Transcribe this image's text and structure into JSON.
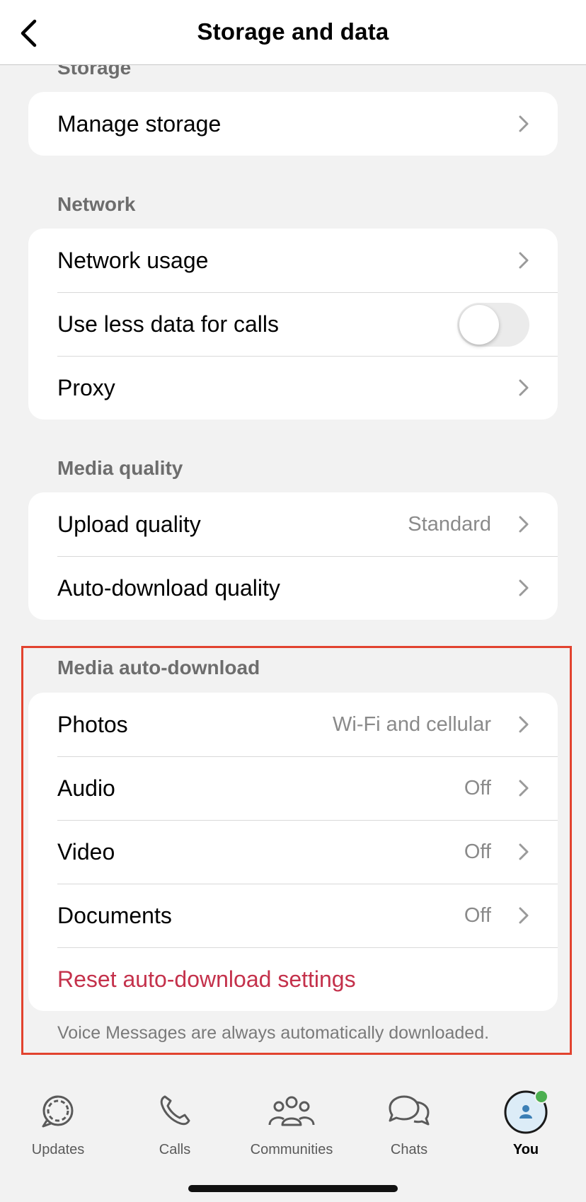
{
  "header": {
    "title": "Storage and data",
    "back_icon": "chevron-left-icon"
  },
  "sections": {
    "storage": {
      "title": "Storage",
      "rows": [
        {
          "label": "Manage storage"
        }
      ]
    },
    "network": {
      "title": "Network",
      "rows": [
        {
          "label": "Network usage"
        },
        {
          "label": "Use less data for calls",
          "toggle_on": false
        },
        {
          "label": "Proxy"
        }
      ]
    },
    "media_quality": {
      "title": "Media quality",
      "rows": [
        {
          "label": "Upload quality",
          "value": "Standard"
        },
        {
          "label": "Auto-download quality"
        }
      ]
    },
    "media_auto_download": {
      "title": "Media auto-download",
      "rows": [
        {
          "label": "Photos",
          "value": "Wi-Fi and cellular"
        },
        {
          "label": "Audio",
          "value": "Off"
        },
        {
          "label": "Video",
          "value": "Off"
        },
        {
          "label": "Documents",
          "value": "Off"
        }
      ],
      "reset_label": "Reset auto-download settings",
      "footnote": "Voice Messages are always automatically downloaded."
    }
  },
  "tabbar": {
    "tabs": [
      {
        "label": "Updates",
        "icon": "updates-icon"
      },
      {
        "label": "Calls",
        "icon": "phone-icon"
      },
      {
        "label": "Communities",
        "icon": "communities-icon"
      },
      {
        "label": "Chats",
        "icon": "chats-icon"
      },
      {
        "label": "You",
        "icon": "avatar-icon",
        "active": true
      }
    ]
  },
  "colors": {
    "reset_text": "#c4314b",
    "highlight_border": "#e2432f",
    "status_dot": "#4caf50",
    "avatar_ring": "#1a1a1a",
    "avatar_fill": "#dcecf7"
  }
}
